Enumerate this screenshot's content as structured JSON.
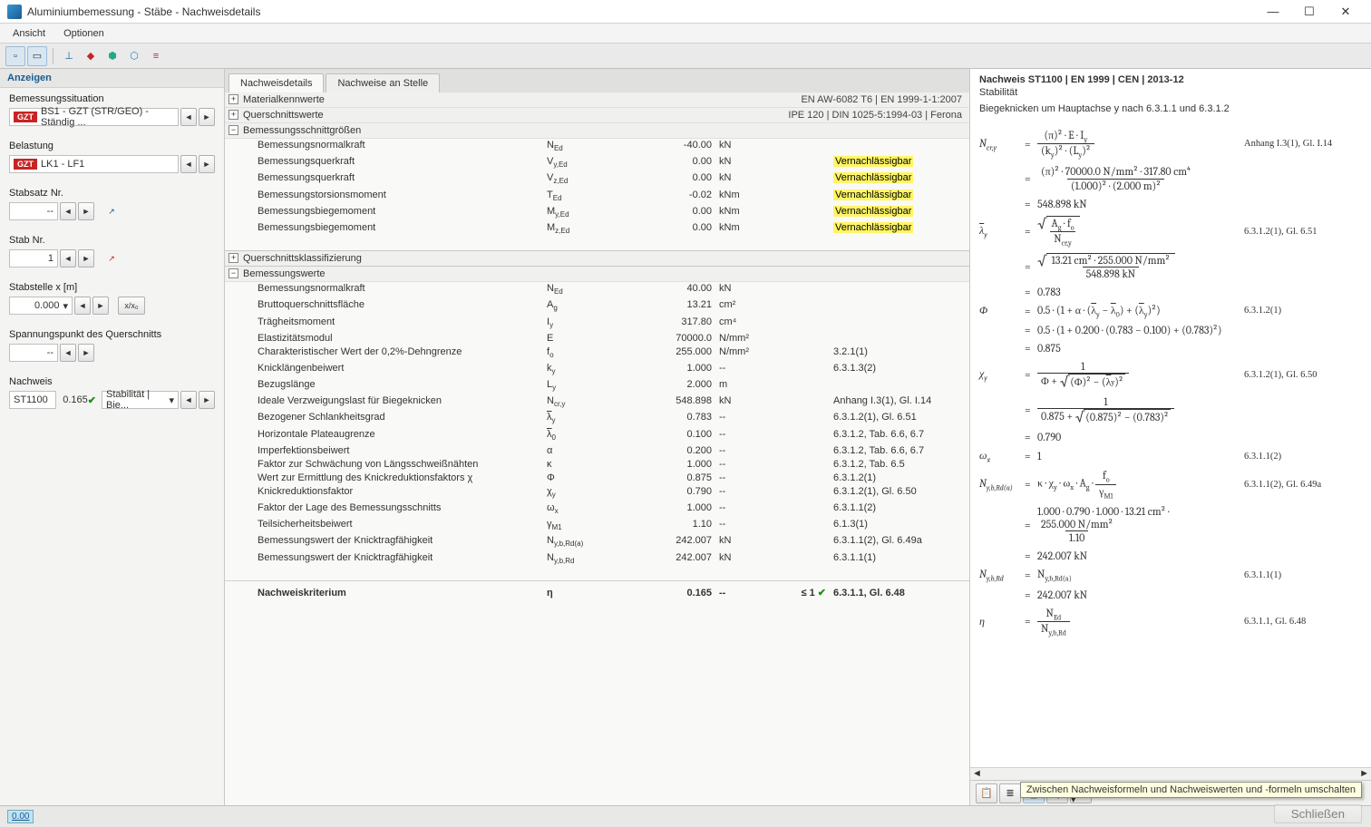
{
  "window": {
    "title": "Aluminiumbemessung - Stäbe - Nachweisdetails"
  },
  "menu": {
    "ansicht": "Ansicht",
    "optionen": "Optionen"
  },
  "left": {
    "header": "Anzeigen",
    "bemessungssituation_label": "Bemessungssituation",
    "bemessungssituation_value": "BS1 - GZT (STR/GEO) - Ständig ...",
    "belastung_label": "Belastung",
    "belastung_value": "LK1 - LF1",
    "stabsatz_label": "Stabsatz Nr.",
    "stabsatz_value": "--",
    "stab_label": "Stab Nr.",
    "stab_value": "1",
    "stabstelle_label": "Stabstelle x [m]",
    "stabstelle_value": "0.000",
    "x_btn": "x/x₀",
    "spannungspunkt_label": "Spannungspunkt des Querschnitts",
    "spannungspunkt_value": "--",
    "nachweis_label": "Nachweis",
    "nachweis_id": "ST1100",
    "nachweis_ratio": "0.165",
    "nachweis_cat": "Stabilität | Bie..."
  },
  "tabs": {
    "details": "Nachweisdetails",
    "stelle": "Nachweise an Stelle"
  },
  "sections": {
    "material": {
      "label": "Materialkennwerte",
      "right": "EN AW-6082 T6 | EN 1999-1-1:2007"
    },
    "querschnitt": {
      "label": "Querschnittswerte",
      "right": "IPE 120 | DIN 1025-5:1994-03 | Ferona"
    },
    "schnittgroessen": {
      "label": "Bemessungsschnittgrößen"
    },
    "klassifizierung": {
      "label": "Querschnittsklassifizierung"
    },
    "bemessungswerte": {
      "label": "Bemessungswerte"
    }
  },
  "rows_forces": [
    {
      "name": "Bemessungsnormalkraft",
      "sym": "N<sub>Ed</sub>",
      "val": "-40.00",
      "unit": "kN",
      "note": ""
    },
    {
      "name": "Bemessungsquerkraft",
      "sym": "V<sub>y,Ed</sub>",
      "val": "0.00",
      "unit": "kN",
      "note": "Vernachlässigbar"
    },
    {
      "name": "Bemessungsquerkraft",
      "sym": "V<sub>z,Ed</sub>",
      "val": "0.00",
      "unit": "kN",
      "note": "Vernachlässigbar"
    },
    {
      "name": "Bemessungstorsionsmoment",
      "sym": "T<sub>Ed</sub>",
      "val": "-0.02",
      "unit": "kNm",
      "note": "Vernachlässigbar"
    },
    {
      "name": "Bemessungsbiegemoment",
      "sym": "M<sub>y,Ed</sub>",
      "val": "0.00",
      "unit": "kNm",
      "note": "Vernachlässigbar"
    },
    {
      "name": "Bemessungsbiegemoment",
      "sym": "M<sub>z,Ed</sub>",
      "val": "0.00",
      "unit": "kNm",
      "note": "Vernachlässigbar"
    }
  ],
  "rows_design": [
    {
      "name": "Bemessungsnormalkraft",
      "sym": "N<sub>Ed</sub>",
      "val": "40.00",
      "unit": "kN",
      "ref": ""
    },
    {
      "name": "Bruttoquerschnittsfläche",
      "sym": "A<sub>g</sub>",
      "val": "13.21",
      "unit": "cm²",
      "ref": ""
    },
    {
      "name": "Trägheitsmoment",
      "sym": "I<sub>y</sub>",
      "val": "317.80",
      "unit": "cm⁴",
      "ref": ""
    },
    {
      "name": "Elastizitätsmodul",
      "sym": "E",
      "val": "70000.0",
      "unit": "N/mm²",
      "ref": ""
    },
    {
      "name": "Charakteristischer Wert der 0,2%-Dehngrenze",
      "sym": "f<sub>o</sub>",
      "val": "255.000",
      "unit": "N/mm²",
      "ref": "3.2.1(1)"
    },
    {
      "name": "Knicklängenbeiwert",
      "sym": "k<sub>y</sub>",
      "val": "1.000",
      "unit": "--",
      "ref": "6.3.1.3(2)"
    },
    {
      "name": "Bezugslänge",
      "sym": "L<sub>y</sub>",
      "val": "2.000",
      "unit": "m",
      "ref": ""
    },
    {
      "name": "Ideale Verzweigungslast für Biegeknicken",
      "sym": "N<sub>cr,y</sub>",
      "val": "548.898",
      "unit": "kN",
      "ref": "Anhang I.3(1), Gl. I.14"
    },
    {
      "name": "Bezogener Schlankheitsgrad",
      "sym": "<span class='ov'>λ</span><sub>y</sub>",
      "val": "0.783",
      "unit": "--",
      "ref": "6.3.1.2(1), Gl. 6.51"
    },
    {
      "name": "Horizontale Plateaugrenze",
      "sym": "<span class='ov'>λ</span><sub>0</sub>",
      "val": "0.100",
      "unit": "--",
      "ref": "6.3.1.2, Tab. 6.6, 6.7"
    },
    {
      "name": "Imperfektionsbeiwert",
      "sym": "α",
      "val": "0.200",
      "unit": "--",
      "ref": "6.3.1.2, Tab. 6.6, 6.7"
    },
    {
      "name": "Faktor zur Schwächung von Längsschweißnähten",
      "sym": "κ",
      "val": "1.000",
      "unit": "--",
      "ref": "6.3.1.2, Tab. 6.5"
    },
    {
      "name": "Wert zur Ermittlung des Knickreduktionsfaktors χ",
      "sym": "Φ",
      "val": "0.875",
      "unit": "--",
      "ref": "6.3.1.2(1)"
    },
    {
      "name": "Knickreduktionsfaktor",
      "sym": "χ<sub>y</sub>",
      "val": "0.790",
      "unit": "--",
      "ref": "6.3.1.2(1), Gl. 6.50"
    },
    {
      "name": "Faktor der Lage des Bemessungsschnitts",
      "sym": "ω<sub>x</sub>",
      "val": "1.000",
      "unit": "--",
      "ref": "6.3.1.1(2)"
    },
    {
      "name": "Teilsicherheitsbeiwert",
      "sym": "γ<sub>M1</sub>",
      "val": "1.10",
      "unit": "--",
      "ref": "6.1.3(1)"
    },
    {
      "name": "Bemessungswert der Knicktragfähigkeit",
      "sym": "N<sub>y,b,Rd(a)</sub>",
      "val": "242.007",
      "unit": "kN",
      "ref": "6.3.1.1(2), Gl. 6.49a"
    },
    {
      "name": "Bemessungswert der Knicktragfähigkeit",
      "sym": "N<sub>y,b,Rd</sub>",
      "val": "242.007",
      "unit": "kN",
      "ref": "6.3.1.1(1)"
    }
  ],
  "criterion": {
    "name": "Nachweiskriterium",
    "sym": "η",
    "val": "0.165",
    "unit": "--",
    "limit": "≤ 1",
    "ref": "6.3.1.1, Gl. 6.48"
  },
  "right": {
    "header": "Nachweis ST1100 | EN 1999 | CEN | 2013-12",
    "stab_label": "Stabilität",
    "desc": "Biegeknicken um Hauptachse y nach 6.3.1.1 und 6.3.1.2",
    "refs": {
      "ncry": "Anhang I.3(1), Gl. I.14",
      "lambda": "6.3.1.2(1), Gl. 6.51",
      "phi": "6.3.1.2(1)",
      "chi": "6.3.1.2(1), Gl. 6.50",
      "omegax": "6.3.1.1(2)",
      "nybrda": "6.3.1.1(2), Gl. 6.49a",
      "nybrd": "6.3.1.1(1)",
      "eta": "6.3.1.1, Gl. 6.48"
    }
  },
  "tooltip": "Zwischen Nachweisformeln und Nachweiswerten und -formeln umschalten",
  "close": "Schließen",
  "status_num": "0.00",
  "chart_data": {
    "type": "table",
    "title": "Bemessungswerte – ST1100 Stabilität Biegeknicken y",
    "rows": [
      [
        "N_Ed",
        -40.0,
        "kN"
      ],
      [
        "V_y,Ed",
        0.0,
        "kN"
      ],
      [
        "V_z,Ed",
        0.0,
        "kN"
      ],
      [
        "T_Ed",
        -0.02,
        "kNm"
      ],
      [
        "M_y,Ed",
        0.0,
        "kNm"
      ],
      [
        "M_z,Ed",
        0.0,
        "kNm"
      ],
      [
        "A_g",
        13.21,
        "cm2"
      ],
      [
        "I_y",
        317.8,
        "cm4"
      ],
      [
        "E",
        70000.0,
        "N/mm2"
      ],
      [
        "f_o",
        255.0,
        "N/mm2"
      ],
      [
        "k_y",
        1.0,
        ""
      ],
      [
        "L_y",
        2.0,
        "m"
      ],
      [
        "N_cr,y",
        548.898,
        "kN"
      ],
      [
        "lambda_bar_y",
        0.783,
        ""
      ],
      [
        "lambda_bar_0",
        0.1,
        ""
      ],
      [
        "alpha",
        0.2,
        ""
      ],
      [
        "kappa",
        1.0,
        ""
      ],
      [
        "Phi",
        0.875,
        ""
      ],
      [
        "chi_y",
        0.79,
        ""
      ],
      [
        "omega_x",
        1.0,
        ""
      ],
      [
        "gamma_M1",
        1.1,
        ""
      ],
      [
        "N_y,b,Rd(a)",
        242.007,
        "kN"
      ],
      [
        "N_y,b,Rd",
        242.007,
        "kN"
      ],
      [
        "eta",
        0.165,
        ""
      ]
    ]
  }
}
